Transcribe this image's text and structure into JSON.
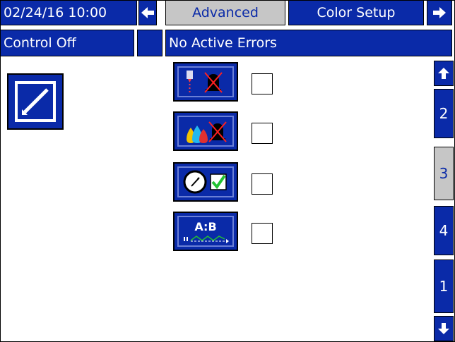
{
  "header": {
    "datetime": "02/24/16 10:00",
    "nav_left_icon": "arrow-left-icon",
    "tabs": [
      {
        "label": "Advanced",
        "active": true
      },
      {
        "label": "Color Setup",
        "active": false
      }
    ],
    "nav_right_icon": "arrow-right-icon"
  },
  "status": {
    "control": "Control Off",
    "errors": "No Active Errors"
  },
  "side_tabs": {
    "up_icon": "arrow-up-icon",
    "items": [
      "2",
      "3",
      "4",
      "1"
    ],
    "active": "3",
    "down_icon": "arrow-down-icon"
  },
  "main": {
    "edit_icon": "edit-pencil-icon",
    "options": [
      {
        "icon": "dispense-alarm-muted-icon",
        "checked": false
      },
      {
        "icon": "color-alarm-muted-icon",
        "checked": false
      },
      {
        "icon": "gauge-check-icon",
        "checked": false
      },
      {
        "icon": "ratio-ab-icon",
        "icon_text": "A:B",
        "checked": false
      }
    ]
  },
  "colors": {
    "accent": "#0a2aa8",
    "active_tab": "#c6c6c6",
    "alarm_x": "#ff2020",
    "check": "#22c232"
  }
}
